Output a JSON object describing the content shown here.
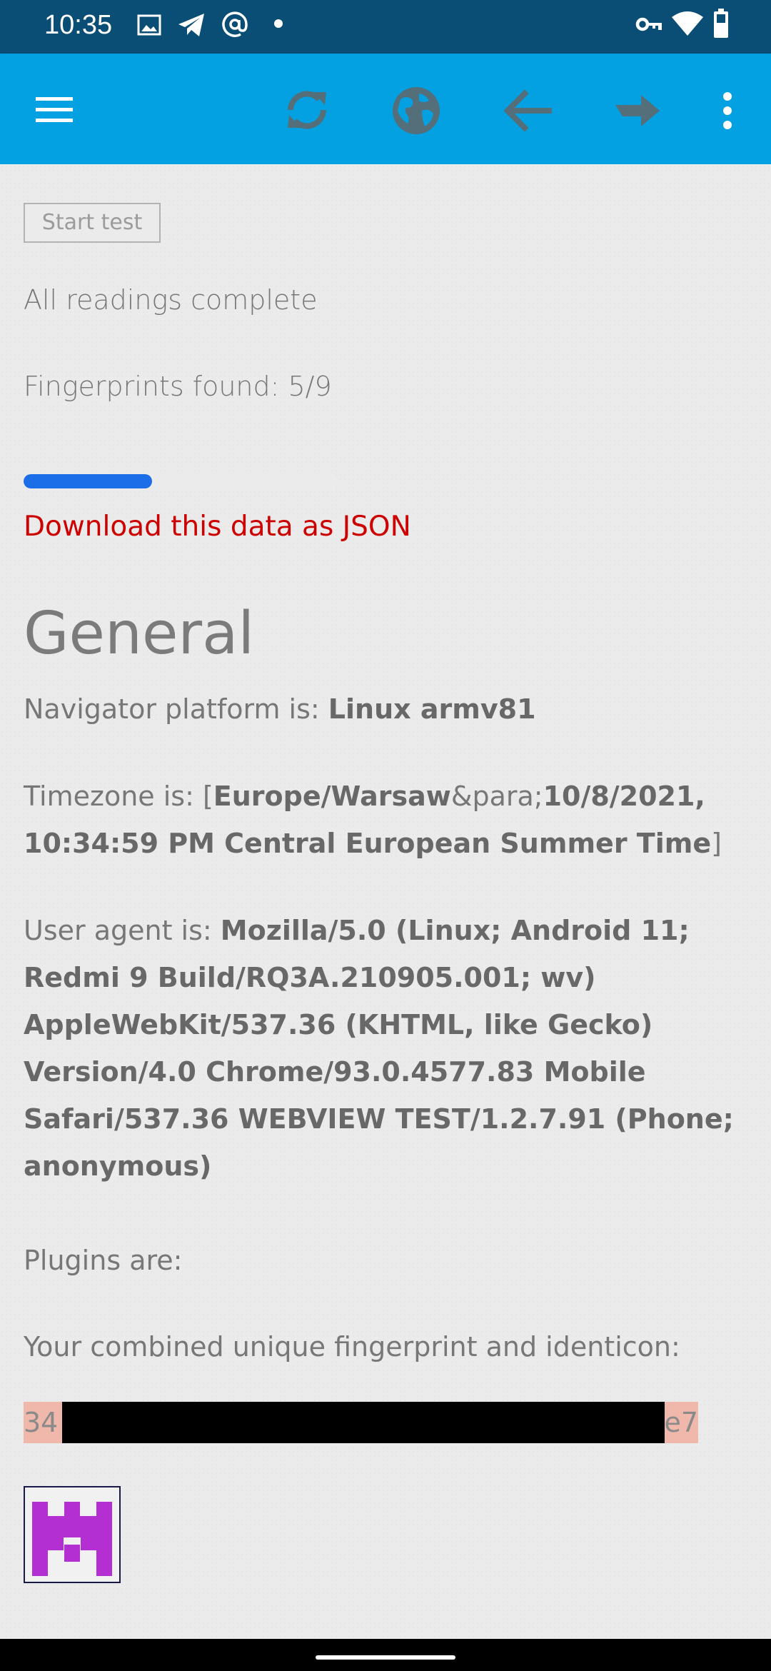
{
  "status_bar": {
    "time": "10:35",
    "icons": [
      "gallery-icon",
      "telegram-icon",
      "at-icon",
      "dot-icon",
      "vpn-key-icon",
      "wifi-icon",
      "battery-icon"
    ]
  },
  "toolbar": {
    "icons": [
      "menu-icon",
      "refresh-icon",
      "globe-icon",
      "back-icon",
      "forward-icon",
      "more-icon"
    ],
    "color": "#03a1e2"
  },
  "main": {
    "start_button_label": "Start test",
    "status_text": "All readings complete",
    "fingerprints_found": "Fingerprints found: 5/9",
    "progress": 0.41,
    "download_link": "Download this data as JSON",
    "section_heading": "General",
    "platform_label": "Navigator platform is: ",
    "platform_value": "Linux armv81",
    "timezone_label": "Timezone is: [",
    "timezone_zone": "Europe/Warsaw",
    "timezone_sep": "&para;",
    "timezone_time": "10/8/2021, 10:34:59 PM Central European Summer Time",
    "timezone_close": "]",
    "ua_label": "User agent is: ",
    "ua_value": "Mozilla/5.0 (Linux; Android 11; Redmi 9 Build/RQ3A.210905.001; wv) AppleWebKit/537.36 (KHTML, like Gecko) Version/4.0 Chrome/93.0.4577.83 Mobile Safari/537.36 WEBVIEW TEST/1.2.7.91 (Phone; anonymous)",
    "plugins_label": "Plugins are:",
    "combined_label": "Your combined unique fingerprint and identicon:",
    "fingerprint_start": "34",
    "fingerprint_end": "e7",
    "identicon_color": "#b32fd1"
  }
}
